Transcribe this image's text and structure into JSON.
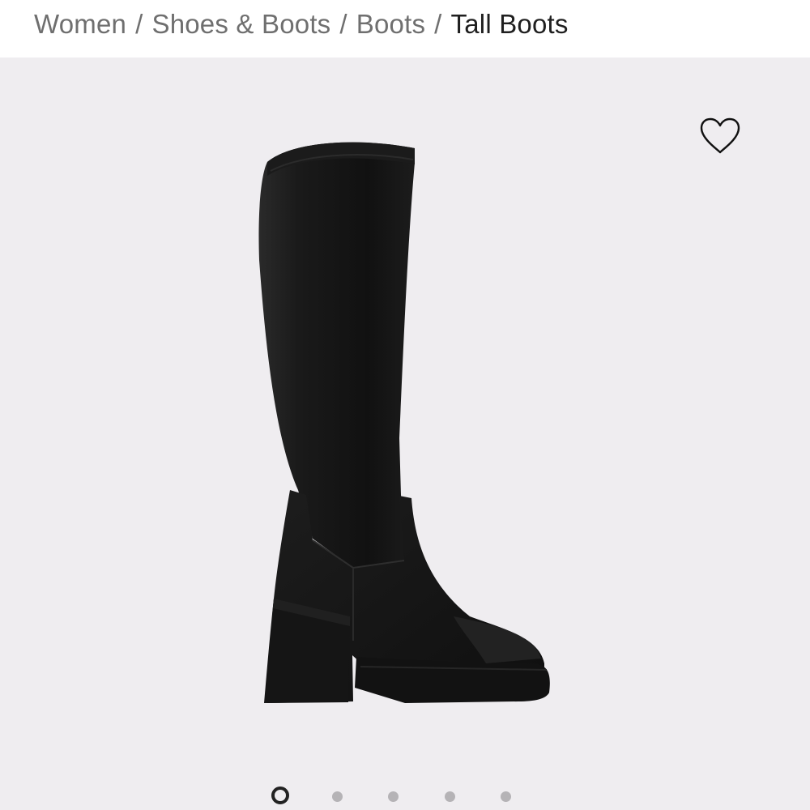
{
  "breadcrumb": {
    "items": [
      "Women",
      "Shoes & Boots",
      "Boots"
    ],
    "current": "Tall Boots",
    "separator": "/"
  },
  "gallery": {
    "background": "#efedf0",
    "image": "black-tall-platform-boot",
    "wishlist_icon": "heart-outline-icon",
    "slide_count": 5,
    "active_slide": 1
  },
  "colors": {
    "text_muted": "#6f6f6f",
    "text_current": "#1f1f1f",
    "boot": "#141414"
  }
}
